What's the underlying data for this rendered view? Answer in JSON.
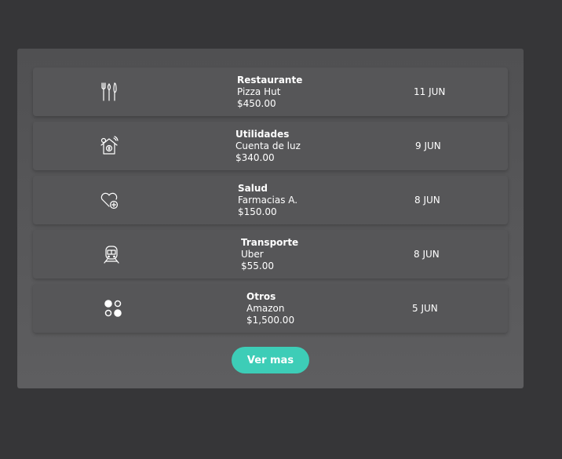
{
  "transactions": [
    {
      "category": "Restaurante",
      "merchant": "Pizza Hut",
      "amount": "$450.00",
      "date": "11 JUN",
      "icon": "fork-knife-icon"
    },
    {
      "category": "Utilidades",
      "merchant": "Cuenta de luz",
      "amount": "$340.00",
      "date": "9 JUN",
      "icon": "house-bill-icon"
    },
    {
      "category": "Salud",
      "merchant": "Farmacias A.",
      "amount": "$150.00",
      "date": "8 JUN",
      "icon": "heart-plus-icon"
    },
    {
      "category": "Transporte",
      "merchant": "Uber",
      "amount": "$55.00",
      "date": "8 JUN",
      "icon": "train-icon"
    },
    {
      "category": "Otros",
      "merchant": "Amazon",
      "amount": "$1,500.00",
      "date": "5 JUN",
      "icon": "dots-grid-icon"
    }
  ],
  "more_button": {
    "label": "Ver mas"
  },
  "colors": {
    "accent": "#3dcdb7",
    "background": "#363638",
    "panel": "#58585a"
  }
}
